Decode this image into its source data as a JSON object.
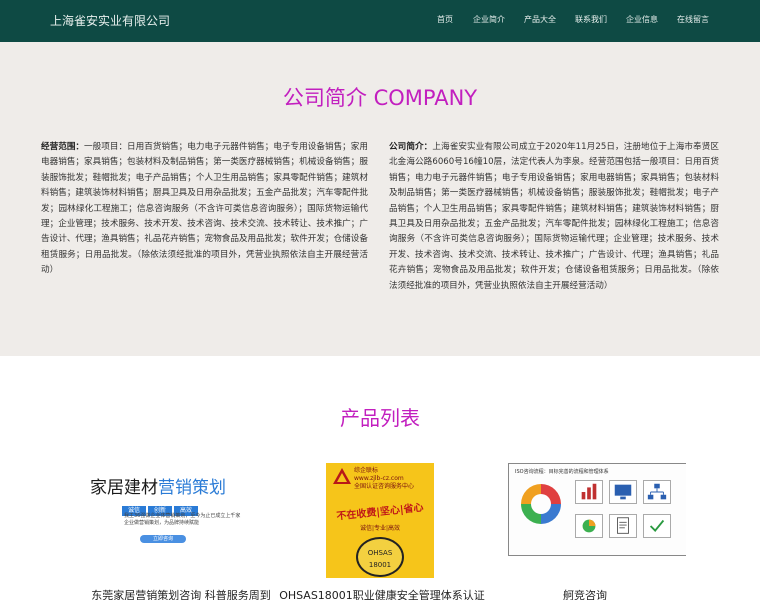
{
  "brand": "上海雀安实业有限公司",
  "nav": [
    "首页",
    "企业简介",
    "产品大全",
    "联系我们",
    "企业信息",
    "在线留言"
  ],
  "about": {
    "title": "公司简介 COMPANY",
    "left_label": "经营范围：",
    "left_text": "一般项目：日用百货销售；电力电子元器件销售；电子专用设备销售；家用电器销售；家具销售；包装材料及制品销售；第一类医疗器械销售；机械设备销售；服装服饰批发；鞋帽批发；电子产品销售；个人卫生用品销售；家具零配件销售；建筑材料销售；建筑装饰材料销售；厨具卫具及日用杂品批发；五金产品批发；汽车零配件批发；园林绿化工程施工；信息咨询服务（不含许可类信息咨询服务）；国际货物运输代理；企业管理；技术服务、技术开发、技术咨询、技术交流、技术转让、技术推广；广告设计、代理；渔具销售；礼品花卉销售；宠物食品及用品批发；软件开发；仓储设备租赁服务；日用品批发。（除依法须经批准的项目外，凭营业执照依法自主开展经营活动）",
    "right_label": "公司简介：",
    "right_text": "上海雀安实业有限公司成立于2020年11月25日，注册地位于上海市奉贤区北金海公路6060号16幢10层，法定代表人为李泉。经营范围包括一般项目：日用百货销售；电力电子元器件销售；电子专用设备销售；家用电器销售；家具销售；包装材料及制品销售；第一类医疗器械销售；机械设备销售；服装服饰批发；鞋帽批发；电子产品销售；个人卫生用品销售；家具零配件销售；建筑材料销售；建筑装饰材料销售；厨具卫具及日用杂品批发；五金产品批发；汽车零配件批发；园林绿化工程施工；信息咨询服务（不含许可类信息咨询服务）；国际货物运输代理；企业管理；技术服务、技术开发、技术咨询、技术交流、技术转让、技术推广；广告设计、代理；渔具销售；礼品花卉销售；宠物食品及用品批发；软件开发；仓储设备租赁服务；日用品批发。（除依法须经批准的项目外，凭营业执照依法自主开展经营活动）"
  },
  "products": {
    "title": "产品列表",
    "items": [
      {
        "caption": "东莞家居营销策划咨询 科普服务周到",
        "image": {
          "title_plain": "家居建材",
          "title_accent": "营销策划",
          "chips": [
            "诚信",
            "创新",
            "高效"
          ],
          "desc": "我主36强做企业体营销策划，至今为止已成立上千家企业做营销策划，为品牌持续赋能",
          "pill": "立即咨询"
        }
      },
      {
        "caption": "OHSAS18001职业健康安全管理体系认证",
        "image": {
          "header": "综企联标",
          "url": "www.zjlb-cz.com",
          "sub1": "全国认证咨询服务中心",
          "slogan": "不在收费|坚心|省心",
          "sub2": "诚信|专业|高效",
          "badge": "OHSAS 18001"
        }
      },
      {
        "caption": "舸竞咨询",
        "image": {
          "heading": "ISO咨询流程：目标完善的流程和管理体系"
        }
      }
    ]
  },
  "colors": {
    "nav_bg": "#0e4a44",
    "accent": "#c21fbf",
    "about_bg": "#efece9"
  }
}
